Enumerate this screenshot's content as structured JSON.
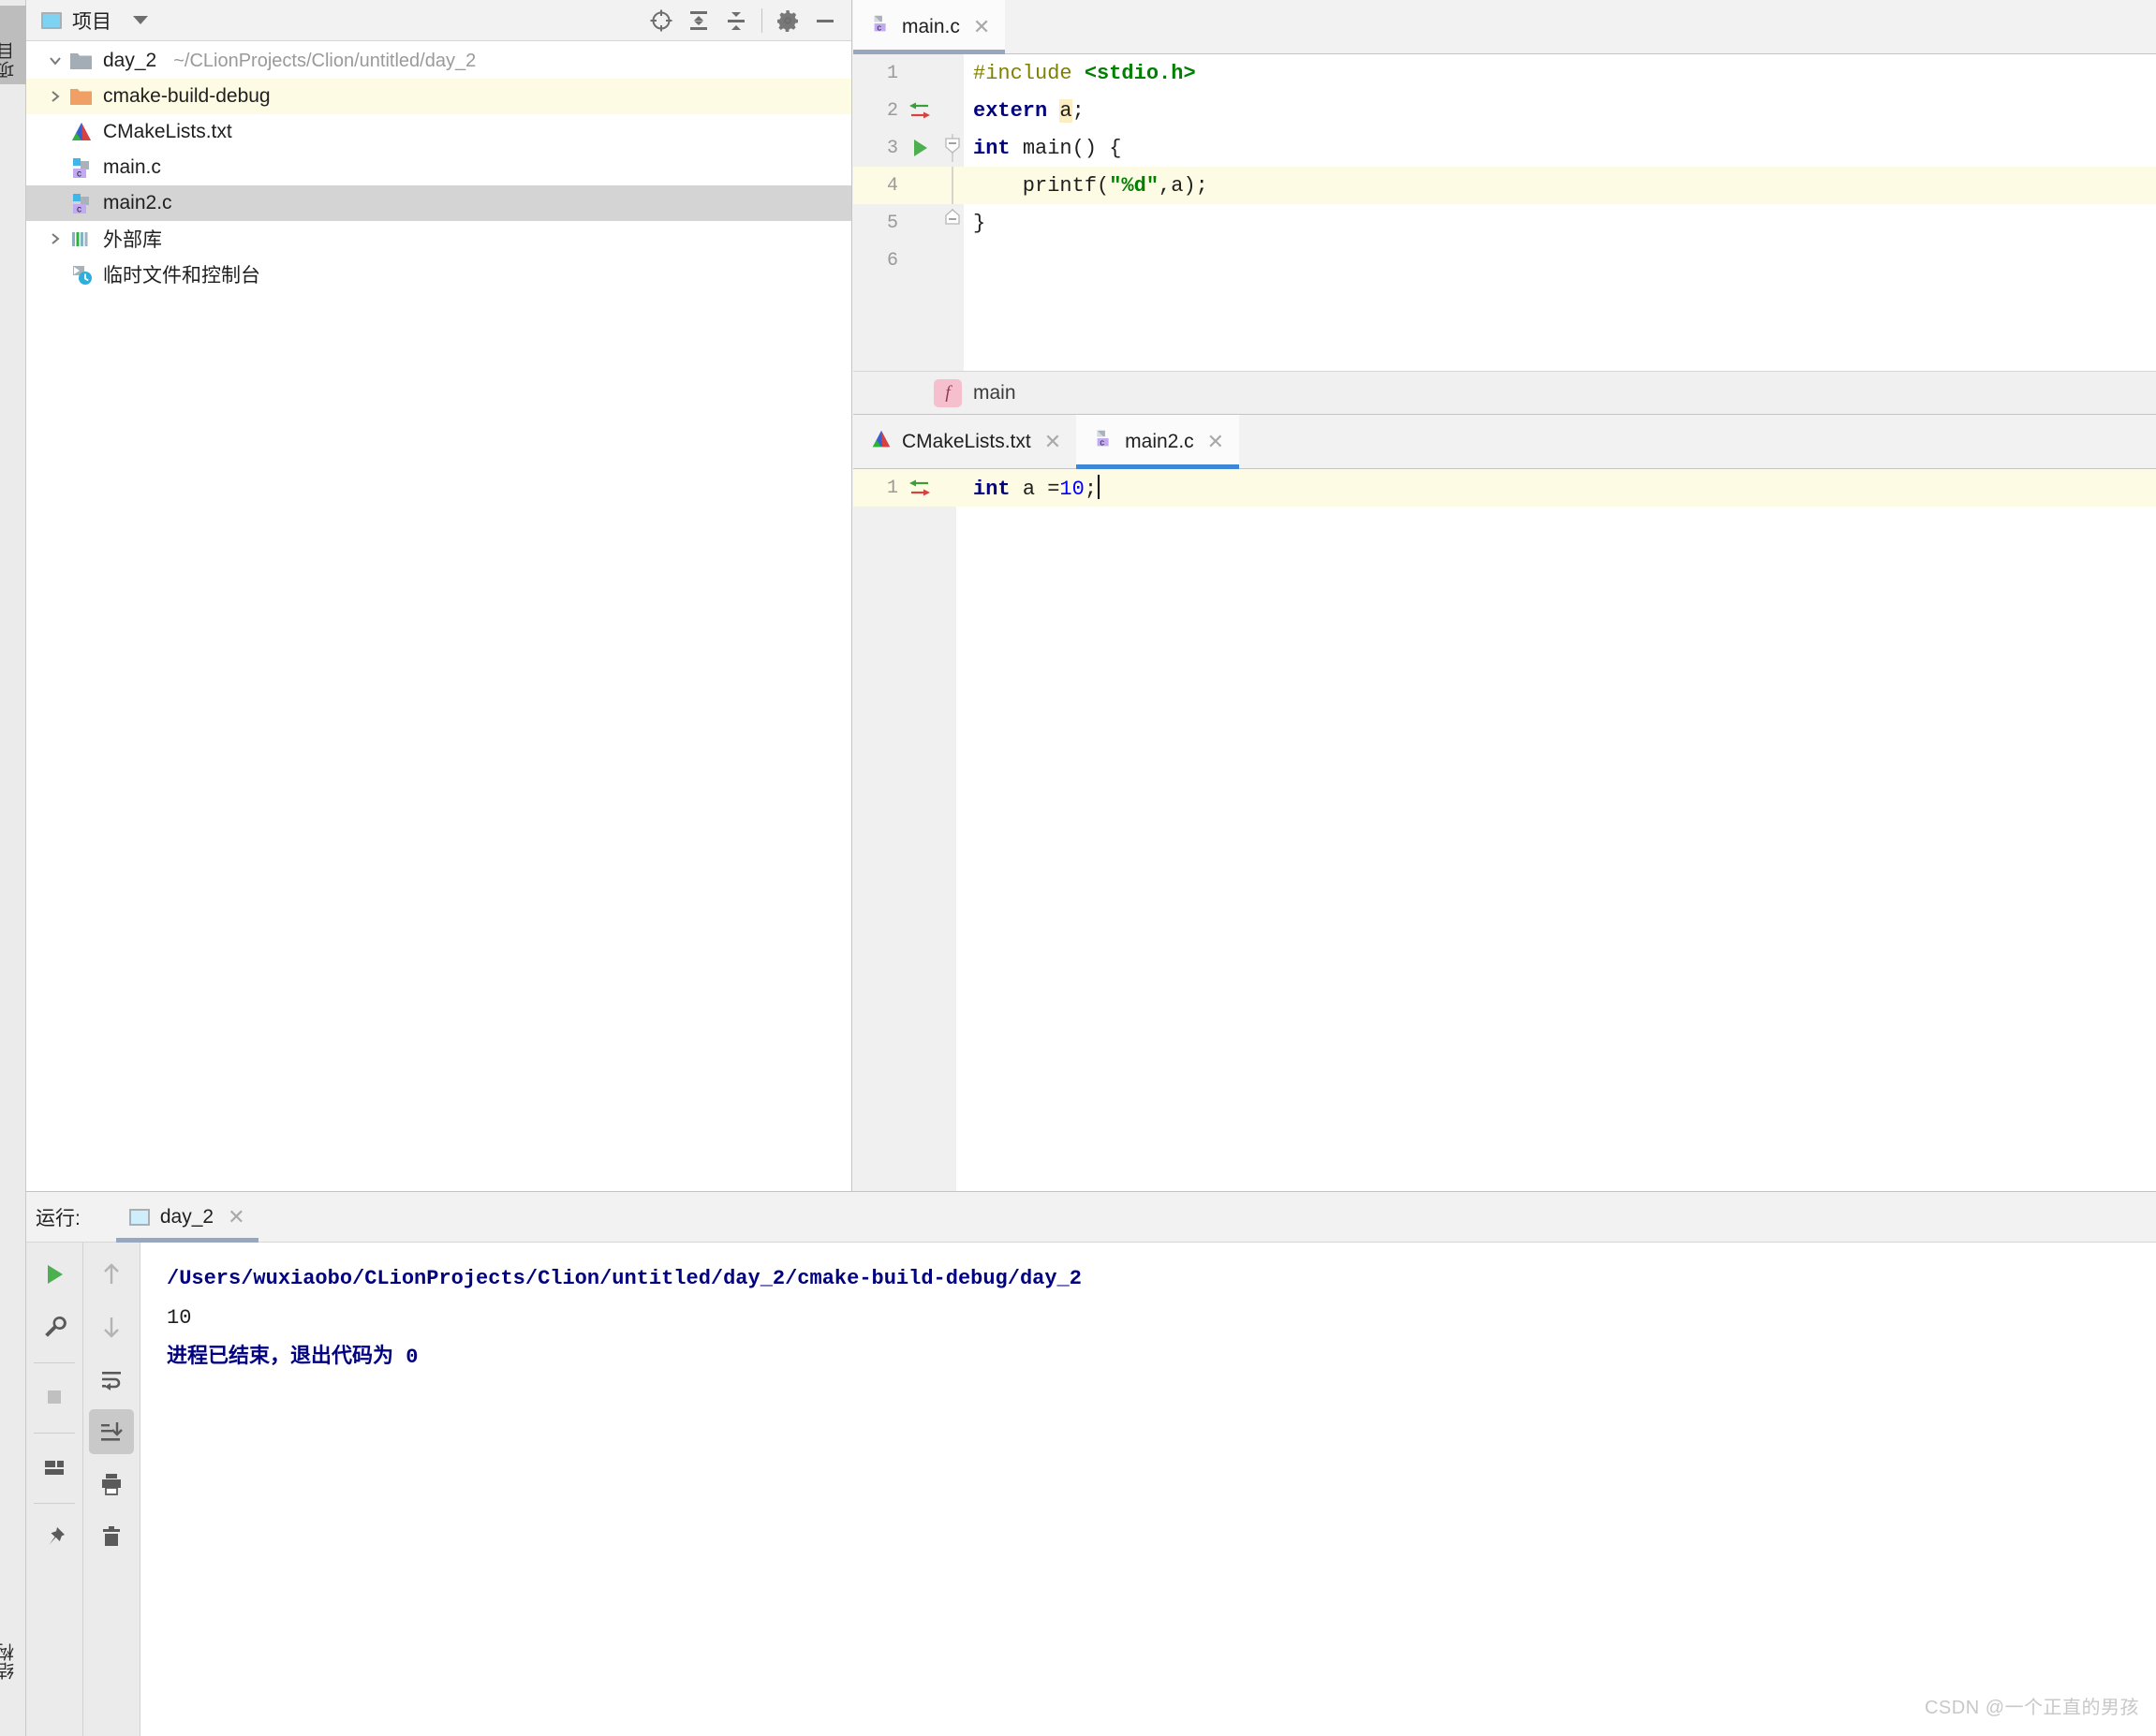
{
  "left_strip": {
    "tabs": [
      {
        "label": "项目",
        "name": "tool-window-tab-project",
        "selected": true
      },
      {
        "label": "结构",
        "name": "tool-window-tab-structure",
        "selected": false
      }
    ]
  },
  "project_panel": {
    "title": "项目",
    "title_icon": "project-window-icon",
    "dropdown_icon": "chevron-down-icon",
    "toolbar": [
      {
        "name": "locate-file-icon",
        "tooltip": "select-opened-file"
      },
      {
        "name": "expand-all-icon",
        "tooltip": "expand-all"
      },
      {
        "name": "collapse-all-icon",
        "tooltip": "collapse-all"
      },
      {
        "name": "gear-icon",
        "tooltip": "settings"
      },
      {
        "name": "minimize-icon",
        "tooltip": "hide"
      }
    ],
    "tree": [
      {
        "label": "day_2",
        "path": "~/CLionProjects/Clion/untitled/day_2",
        "icon": "folder-module-icon",
        "twisty": "expanded",
        "depth": 0,
        "highlight": "none"
      },
      {
        "label": "cmake-build-debug",
        "path": "",
        "icon": "folder-excluded-icon",
        "twisty": "collapsed",
        "depth": 1,
        "highlight": "cream"
      },
      {
        "label": "CMakeLists.txt",
        "path": "",
        "icon": "cmake-file-icon",
        "twisty": "none",
        "depth": 1,
        "highlight": "none"
      },
      {
        "label": "main.c",
        "path": "",
        "icon": "c-file-icon",
        "twisty": "none",
        "depth": 1,
        "highlight": "none"
      },
      {
        "label": "main2.c",
        "path": "",
        "icon": "c-file-icon",
        "twisty": "none",
        "depth": 1,
        "highlight": "selected"
      },
      {
        "label": "外部库",
        "path": "",
        "icon": "external-libraries-icon",
        "twisty": "collapsed",
        "depth": 0,
        "highlight": "none"
      },
      {
        "label": "临时文件和控制台",
        "path": "",
        "icon": "scratches-consoles-icon",
        "twisty": "none",
        "depth": 0,
        "highlight": "none"
      }
    ]
  },
  "editor_top": {
    "tabs": [
      {
        "label": "main.c",
        "icon": "c-file-icon",
        "active": true,
        "close_icon": "close-icon"
      }
    ],
    "lines": [
      {
        "number": "1",
        "gutter_marker": "none",
        "fold": "none",
        "current": false,
        "tokens": [
          {
            "text": "#include ",
            "style": "directive"
          },
          {
            "text": "<stdio.h>",
            "style": "include"
          }
        ]
      },
      {
        "number": "2",
        "gutter_marker": "implemented-arrows-icon",
        "fold": "none",
        "current": false,
        "tokens": [
          {
            "text": "extern ",
            "style": "keyword"
          },
          {
            "text": "a",
            "style": "highlighted-identifier"
          },
          {
            "text": ";",
            "style": "plain"
          }
        ]
      },
      {
        "number": "3",
        "gutter_marker": "run-gutter-icon",
        "fold": "collapse",
        "current": false,
        "tokens": [
          {
            "text": "int ",
            "style": "keyword"
          },
          {
            "text": "main() {",
            "style": "plain"
          }
        ]
      },
      {
        "number": "4",
        "gutter_marker": "none",
        "fold": "none",
        "current": true,
        "tokens": [
          {
            "text": "    printf(",
            "style": "plain"
          },
          {
            "text": "\"%d\"",
            "style": "string"
          },
          {
            "text": ",a);",
            "style": "plain"
          }
        ]
      },
      {
        "number": "5",
        "gutter_marker": "none",
        "fold": "end",
        "current": false,
        "tokens": [
          {
            "text": "}",
            "style": "plain"
          }
        ]
      },
      {
        "number": "6",
        "gutter_marker": "none",
        "fold": "none",
        "current": false,
        "tokens": []
      }
    ],
    "breadcrumb": {
      "badge": "f",
      "label": "main"
    }
  },
  "editor_bottom": {
    "tabs": [
      {
        "label": "CMakeLists.txt",
        "icon": "cmake-file-icon",
        "active": false,
        "close_icon": "close-icon"
      },
      {
        "label": "main2.c",
        "icon": "c-file-icon",
        "active": true,
        "close_icon": "close-icon"
      }
    ],
    "lines": [
      {
        "number": "1",
        "gutter_marker": "implemented-arrows-icon",
        "current": true,
        "tokens": [
          {
            "text": "int ",
            "style": "keyword"
          },
          {
            "text": "a =",
            "style": "plain"
          },
          {
            "text": "10",
            "style": "number"
          },
          {
            "text": ";",
            "style": "plain"
          }
        ]
      }
    ]
  },
  "run_panel": {
    "label": "运行:",
    "tab": {
      "label": "day_2",
      "icon": "run-config-icon",
      "close_icon": "close-icon"
    },
    "tools_left": [
      {
        "name": "rerun-icon"
      },
      {
        "name": "wrench-icon"
      },
      {
        "name": "stop-icon"
      },
      {
        "name": "layout-icon"
      },
      {
        "name": "pin-icon"
      }
    ],
    "tools_right": [
      {
        "name": "arrow-up-icon"
      },
      {
        "name": "arrow-down-icon"
      },
      {
        "name": "soft-wrap-icon"
      },
      {
        "name": "scroll-to-end-icon",
        "active": true
      },
      {
        "name": "print-icon"
      },
      {
        "name": "trash-icon"
      }
    ],
    "console": [
      {
        "text": "/Users/wuxiaobo/CLionProjects/Clion/untitled/day_2/cmake-build-debug/day_2",
        "style": "path"
      },
      {
        "text": "10",
        "style": "output"
      },
      {
        "text": "进程已结束，退出代码为  0",
        "style": "exit"
      }
    ]
  },
  "watermark": "CSDN @一个正直的男孩",
  "colors": {
    "current_line": "#fdfbe3",
    "selection": "#d4d4d4",
    "active_tab_underline": "#3d87d6",
    "inactive_tab_underline": "#98a7bd",
    "keyword": "#000080",
    "string": "#008000",
    "number": "#0000ff",
    "directive": "#808000",
    "panel_bg": "#f2f2f2",
    "gutter_bg": "#f0f0f0"
  }
}
